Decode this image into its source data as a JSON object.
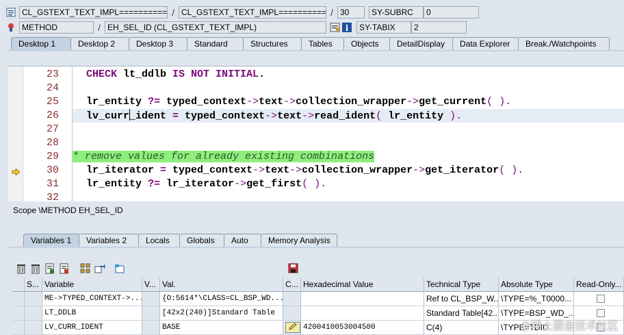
{
  "header": {
    "row1": {
      "program": "CL_GSTEXT_TEXT_IMPL===========",
      "include": "CL_GSTEXT_TEXT_IMPL===========",
      "line": "30",
      "sysfield_name": "SY-SUBRC",
      "sysfield_value": "0",
      "sep": "/"
    },
    "row2": {
      "event_type": "METHOD",
      "event_name": "EH_SEL_ID (CL_GSTEXT_TEXT_IMPL)",
      "sysfield_name": "SY-TABIX",
      "sysfield_value": "2",
      "sep": "/"
    }
  },
  "desktop_tabs": [
    "Desktop 1",
    "Desktop 2",
    "Desktop 3",
    "Standard",
    "Structures",
    "Tables",
    "Objects",
    "DetailDisplay",
    "Data Explorer",
    "Break./Watchpoints"
  ],
  "editor": {
    "lines": [
      {
        "num": "23",
        "kind": "check",
        "t1": "CHECK",
        "t2": " lt_ddlb ",
        "t3": "IS NOT INITIAL",
        "t4": "."
      },
      {
        "num": "24",
        "kind": "empty"
      },
      {
        "num": "25",
        "kind": "getcur",
        "t1": "lr_entity ",
        "t2": "?=",
        "t3": " typed_context",
        "t4": "->",
        "t5": "text",
        "t6": "->",
        "t7": "collection_wrapper",
        "t8": "->",
        "t9": "get_current",
        "t10": "( ).",
        "t11": ""
      },
      {
        "num": "26",
        "kind": "readid",
        "t1": "lv_curr",
        "t2": "_ident ",
        "t3": "=",
        "t4": " typed_context",
        "t5": "->",
        "t6": "text",
        "t7": "->",
        "t8": "read_ident",
        "t9": "( ",
        "t10": "lr_entity",
        "t11": " ).",
        "t12": ""
      },
      {
        "num": "27",
        "kind": "empty"
      },
      {
        "num": "28",
        "kind": "empty"
      },
      {
        "num": "29",
        "kind": "comment",
        "t1": "* remove values for already existing combinations"
      },
      {
        "num": "30",
        "kind": "getiter",
        "t1": "lr_iterator ",
        "t2": "=",
        "t3": " typed_context",
        "t4": "->",
        "t5": "text",
        "t6": "->",
        "t7": "collection_wrapper",
        "t8": "->",
        "t9": "get_iterator",
        "t10": "( ).",
        "t11": ""
      },
      {
        "num": "31",
        "kind": "getfirst",
        "t1": "lr_entity ",
        "t2": "?=",
        "t3": " lr_iterator",
        "t4": "->",
        "t5": "get_first",
        "t6": "( ).",
        "t7": ""
      },
      {
        "num": "32",
        "kind": "empty"
      }
    ]
  },
  "scope_text": "Scope \\METHOD EH_SEL_ID",
  "variable_tabs": [
    "Variables 1",
    "Variables 2",
    "Locals",
    "Globals",
    "Auto",
    "Memory Analysis"
  ],
  "variables_table": {
    "columns": [
      "S...",
      "Variable",
      "V...",
      "Val.",
      "C...",
      "Hexadecimal Value",
      "Technical Type",
      "Absolute Type",
      "Read-Only..."
    ],
    "rows": [
      {
        "variable": "ME->TYPED_CONTEXT->...",
        "value": "{O:5614*\\CLASS=CL_BSP_WD...",
        "hex": "",
        "tech_type": "Ref to CL_BSP_W...",
        "abs_type": "\\TYPE=%_T0000..."
      },
      {
        "variable": "LT_DDLB",
        "value": "[42x2(240)]Standard Table",
        "hex": "",
        "tech_type": "Standard Table[42...",
        "abs_type": "\\TYPE=BSP_WD_..."
      },
      {
        "variable": "LV_CURR_IDENT",
        "value": "BASE",
        "hex": "4200410053004500",
        "tech_type": "C(4)",
        "abs_type": "\\TYPE=TDID"
      }
    ]
  },
  "watermark": "@稀土掘金技术社区",
  "colors": {
    "accent": "#c4d2e1",
    "keyword": "#7b0a7b",
    "comment_bg": "#8fee7c",
    "line_number": "#8a2b2b"
  }
}
